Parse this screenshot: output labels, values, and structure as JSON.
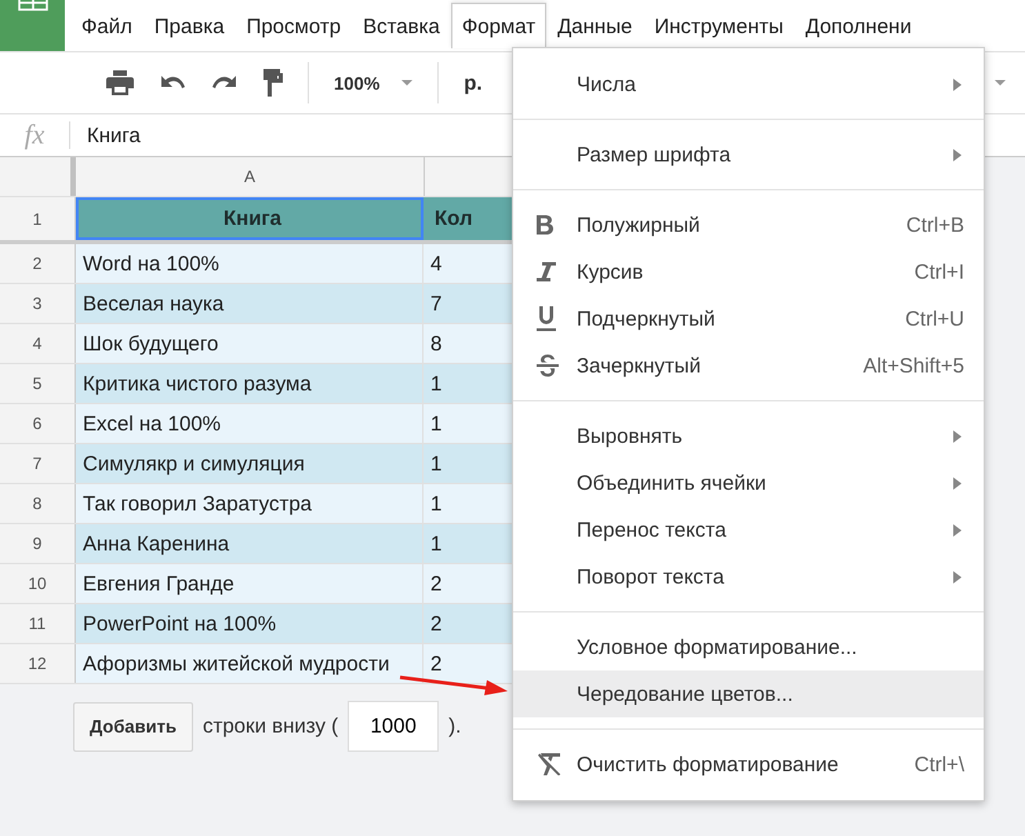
{
  "menubar": [
    {
      "label": "Файл",
      "selected": false
    },
    {
      "label": "Правка",
      "selected": false
    },
    {
      "label": "Просмотр",
      "selected": false
    },
    {
      "label": "Вставка",
      "selected": false
    },
    {
      "label": "Формат",
      "selected": true
    },
    {
      "label": "Данные",
      "selected": false
    },
    {
      "label": "Инструменты",
      "selected": false
    },
    {
      "label": "Дополнени",
      "selected": false
    }
  ],
  "toolbar": {
    "zoom": "100%",
    "currency": "р."
  },
  "formula_bar": {
    "fx": "fx",
    "value": "Книга"
  },
  "table": {
    "columns": [
      "A"
    ],
    "header_row": {
      "number": "1",
      "cells": [
        {
          "text": "Книга",
          "selected": true
        },
        {
          "text": "Кол",
          "selected": false
        }
      ]
    },
    "rows": [
      {
        "number": "2",
        "cells": [
          "Word на 100%",
          "4"
        ]
      },
      {
        "number": "3",
        "cells": [
          "Веселая наука",
          "7"
        ]
      },
      {
        "number": "4",
        "cells": [
          "Шок будущего",
          "8"
        ]
      },
      {
        "number": "5",
        "cells": [
          "Критика чистого разума",
          "1"
        ]
      },
      {
        "number": "6",
        "cells": [
          "Excel на 100%",
          "1"
        ]
      },
      {
        "number": "7",
        "cells": [
          "Симулякр и симуляция",
          "1"
        ]
      },
      {
        "number": "8",
        "cells": [
          "Так говорил Заратустра",
          "1"
        ]
      },
      {
        "number": "9",
        "cells": [
          "Анна Каренина",
          "1"
        ]
      },
      {
        "number": "10",
        "cells": [
          "Евгения Гранде",
          "2"
        ]
      },
      {
        "number": "11",
        "cells": [
          "PowerPoint на 100%",
          "2"
        ]
      },
      {
        "number": "12",
        "cells": [
          "Афоризмы житейской мудрости",
          "2"
        ]
      }
    ]
  },
  "add_rows": {
    "button": "Добавить",
    "text_before": "строки внизу (",
    "value": "1000",
    "text_after": ")."
  },
  "format_menu": [
    [
      {
        "label": "Числа",
        "submenu": true,
        "selected": false
      }
    ],
    [
      {
        "label": "Размер шрифта",
        "submenu": true,
        "selected": false
      }
    ],
    [
      {
        "label": "Полужирный",
        "kind": "bold",
        "shortcut": "Ctrl+B",
        "selected": false
      },
      {
        "label": "Курсив",
        "kind": "italic",
        "shortcut": "Ctrl+I",
        "selected": false
      },
      {
        "label": "Подчеркнутый",
        "kind": "underline",
        "shortcut": "Ctrl+U",
        "selected": false
      },
      {
        "label": "Зачеркнутый",
        "kind": "strike",
        "shortcut": "Alt+Shift+5",
        "selected": false
      }
    ],
    [
      {
        "label": "Выровнять",
        "submenu": true,
        "selected": false
      },
      {
        "label": "Объединить ячейки",
        "submenu": true,
        "selected": false
      },
      {
        "label": "Перенос текста",
        "submenu": true,
        "selected": false
      },
      {
        "label": "Поворот текста",
        "submenu": true,
        "selected": false
      }
    ],
    [
      {
        "label": "Условное форматирование...",
        "selected": false
      },
      {
        "label": "Чередование цветов...",
        "selected": true
      }
    ],
    [
      {
        "label": "Очистить форматирование",
        "kind": "clear",
        "shortcut": "Ctrl+\\",
        "selected": false
      }
    ]
  ]
}
